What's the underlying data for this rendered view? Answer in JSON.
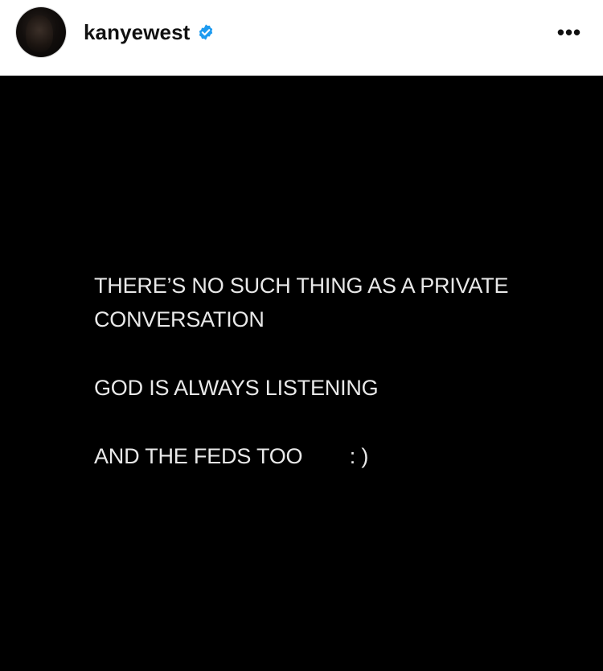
{
  "post": {
    "username": "kanyewest",
    "verified": true,
    "more_icon": "more-horizontal-icon",
    "avatar_icon": "profile-avatar",
    "text_lines": [
      "THERE’S NO SUCH THING AS A PRIVATE",
      "CONVERSATION",
      "GOD IS ALWAYS LISTENING",
      "AND THE FEDS TOO        : )"
    ]
  },
  "colors": {
    "verified_badge": "#1d9bf0",
    "image_background": "#000000",
    "image_text": "#e9e9e9"
  }
}
